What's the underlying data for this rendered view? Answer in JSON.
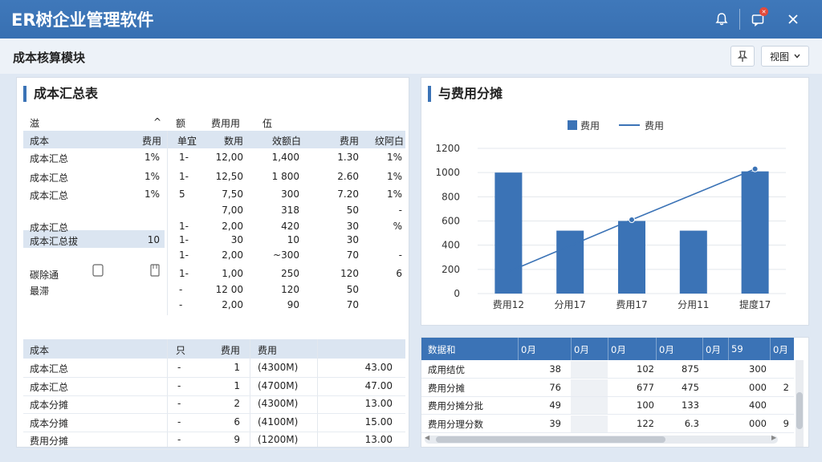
{
  "app": {
    "title": "ER树企业管理软件"
  },
  "module": {
    "title": "成本核算模块",
    "view_label": "视图"
  },
  "summary_panel": {
    "title": "成本汇总表",
    "top_headers": [
      "滋",
      "^",
      "额",
      "费用用",
      "伍"
    ],
    "col_headers": [
      "成本",
      "费用",
      "单宜",
      "数用",
      "效额白",
      "费用",
      "纹阿白"
    ],
    "rows": [
      [
        "成本汇总",
        "1%",
        "1-",
        "12,00",
        "1,400",
        "1.30",
        "1%"
      ],
      [
        "成本汇总",
        "1%",
        "1-",
        "12,50",
        "1 800",
        "2.60",
        "1%"
      ],
      [
        "成本汇总",
        "1%",
        "5",
        "7,50",
        "300",
        "7.20",
        "1%"
      ],
      [
        "",
        "",
        "",
        "7,00",
        "318",
        "50",
        "-"
      ],
      [
        "成本汇总",
        "",
        "1-",
        "2,00",
        "420",
        "30",
        "%"
      ],
      [
        "成本汇总拔",
        "10",
        "1-",
        "30",
        "10",
        "30",
        ""
      ],
      [
        "",
        "",
        "1-",
        "2,00",
        "~300",
        "70",
        "-"
      ],
      [
        "碳除通",
        "",
        "1-",
        "1,00",
        "250",
        "120",
        "6"
      ],
      [
        "最滞",
        "",
        "-",
        "12 00",
        "120",
        "50",
        ""
      ],
      [
        "",
        "",
        "-",
        "2,00",
        "90",
        "70",
        ""
      ]
    ],
    "lower_headers": [
      "成本",
      "只",
      "费用",
      "费用"
    ],
    "lower_rows": [
      [
        "成本汇总",
        "-",
        "1",
        "(4300M)",
        "43.00"
      ],
      [
        "成本汇总",
        "-",
        "1",
        "(4700M)",
        "47.00"
      ],
      [
        "成本分摊",
        "-",
        "2",
        "(4300M)",
        "13.00"
      ],
      [
        "成本分摊",
        "-",
        "6",
        "(4100M)",
        "15.00"
      ],
      [
        "费用分摊",
        "-",
        "9",
        "(1200M)",
        "13.00"
      ]
    ]
  },
  "chart_panel": {
    "title": "与费用分摊"
  },
  "chart_data": {
    "type": "bar",
    "categories": [
      "费用12",
      "分用17",
      "费用17",
      "分用11",
      "提度17"
    ],
    "series": [
      {
        "name": "费用",
        "type": "bar",
        "values": [
          1000,
          520,
          600,
          520,
          1010
        ]
      },
      {
        "name": "费用",
        "type": "line",
        "values": [
          180,
          null,
          610,
          null,
          1030
        ]
      }
    ],
    "ylim": [
      0,
      1200
    ],
    "yticks": [
      0,
      200,
      400,
      600,
      800,
      1000,
      1200
    ],
    "ytick_labels": [
      "0",
      "200",
      "400",
      "600",
      "800",
      "1000",
      "1200"
    ],
    "legend_position": "top-center",
    "bar_color": "#3b73b6",
    "line_color": "#3b73b6",
    "grid": true
  },
  "detail_table": {
    "headers": [
      "数据和",
      "0月",
      "0月",
      "0月",
      "0月",
      "0月",
      "59",
      "0月"
    ],
    "rows": [
      [
        "成用结优",
        "38",
        "",
        "102",
        "875",
        "",
        "300",
        ""
      ],
      [
        "费用分摊",
        "76",
        "",
        "677",
        "475",
        "",
        "000",
        "2"
      ],
      [
        "费用分摊分批",
        "49",
        "",
        "100",
        "133",
        "",
        "400",
        ""
      ],
      [
        "费用分理分数",
        "39",
        "",
        "122",
        "6.3",
        "",
        "000",
        "9"
      ]
    ]
  },
  "colors": {
    "titlebar": "#3b73b6",
    "accent": "#3b73b6",
    "badge": "#e24a3b"
  },
  "icons": [
    "bell-icon",
    "notification-icon",
    "close-icon",
    "pin-icon",
    "chevron-down-icon",
    "checkbox-icon",
    "document-icon"
  ]
}
